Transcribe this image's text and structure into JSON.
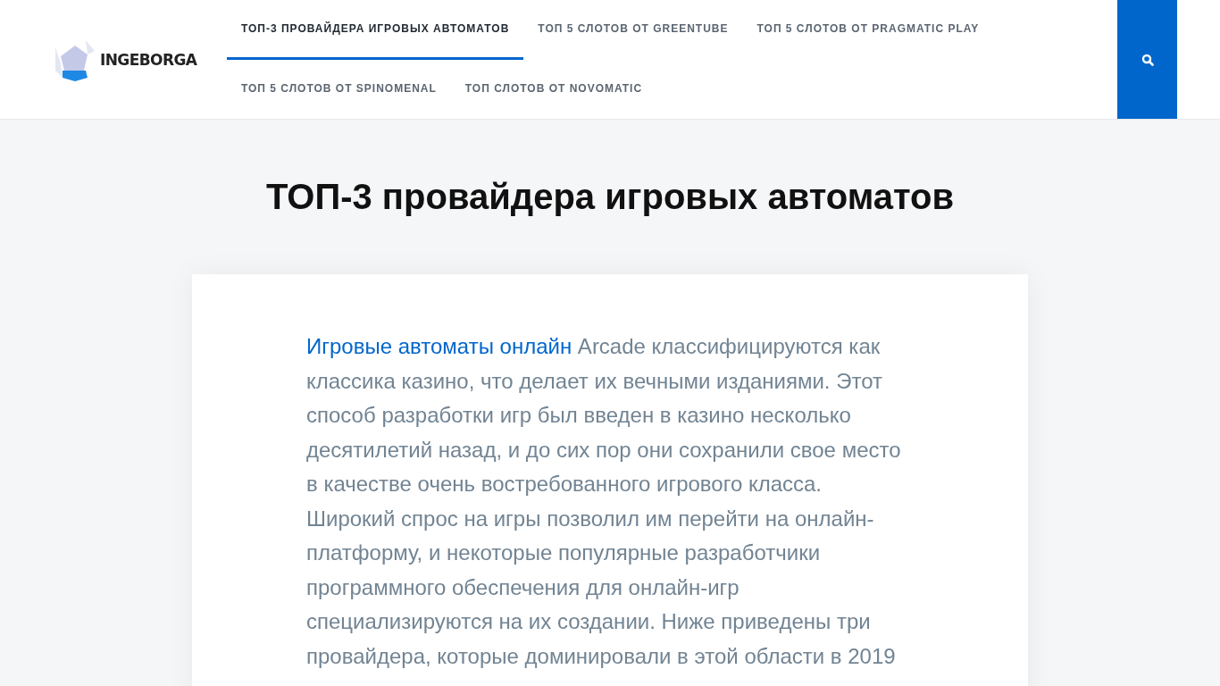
{
  "header": {
    "logo": {
      "text": "INGEBORGA"
    },
    "nav": [
      {
        "label": "ТОП-3 ПРОВАЙДЕРА ИГРОВЫХ АВТОМАТОВ",
        "selected": true
      },
      {
        "label": "ТОП 5 СЛОТОВ ОТ GREENTUBE",
        "selected": false
      },
      {
        "label": "ТОП 5 СЛОТОВ ОТ PRAGMATIC PLAY",
        "selected": false
      },
      {
        "label": "ТОП 5 СЛОТОВ ОТ SPINOMENAL",
        "selected": false
      },
      {
        "label": "ТОП СЛОТОВ ОТ NOVOMATIC",
        "selected": false
      }
    ]
  },
  "page_title": "ТОП-3 провайдера игровых автоматов",
  "article": {
    "link": "Игровые автоматы онлайн",
    "text": " Arcade классифицируются как классика казино, что делает их вечными изданиями. Этот способ разработки игр был введен в казино несколько десятилетий назад, и до сих пор они сохранили свое место в качестве очень востребованного игрового класса. Широкий спрос на игры позволил им перейти на онлайн-платформу, и некоторые популярные разработчики программного обеспечения для онлайн-игр специализируются на их создании. Ниже приведены три провайдера, которые доминировали в этой области в 2019"
  }
}
